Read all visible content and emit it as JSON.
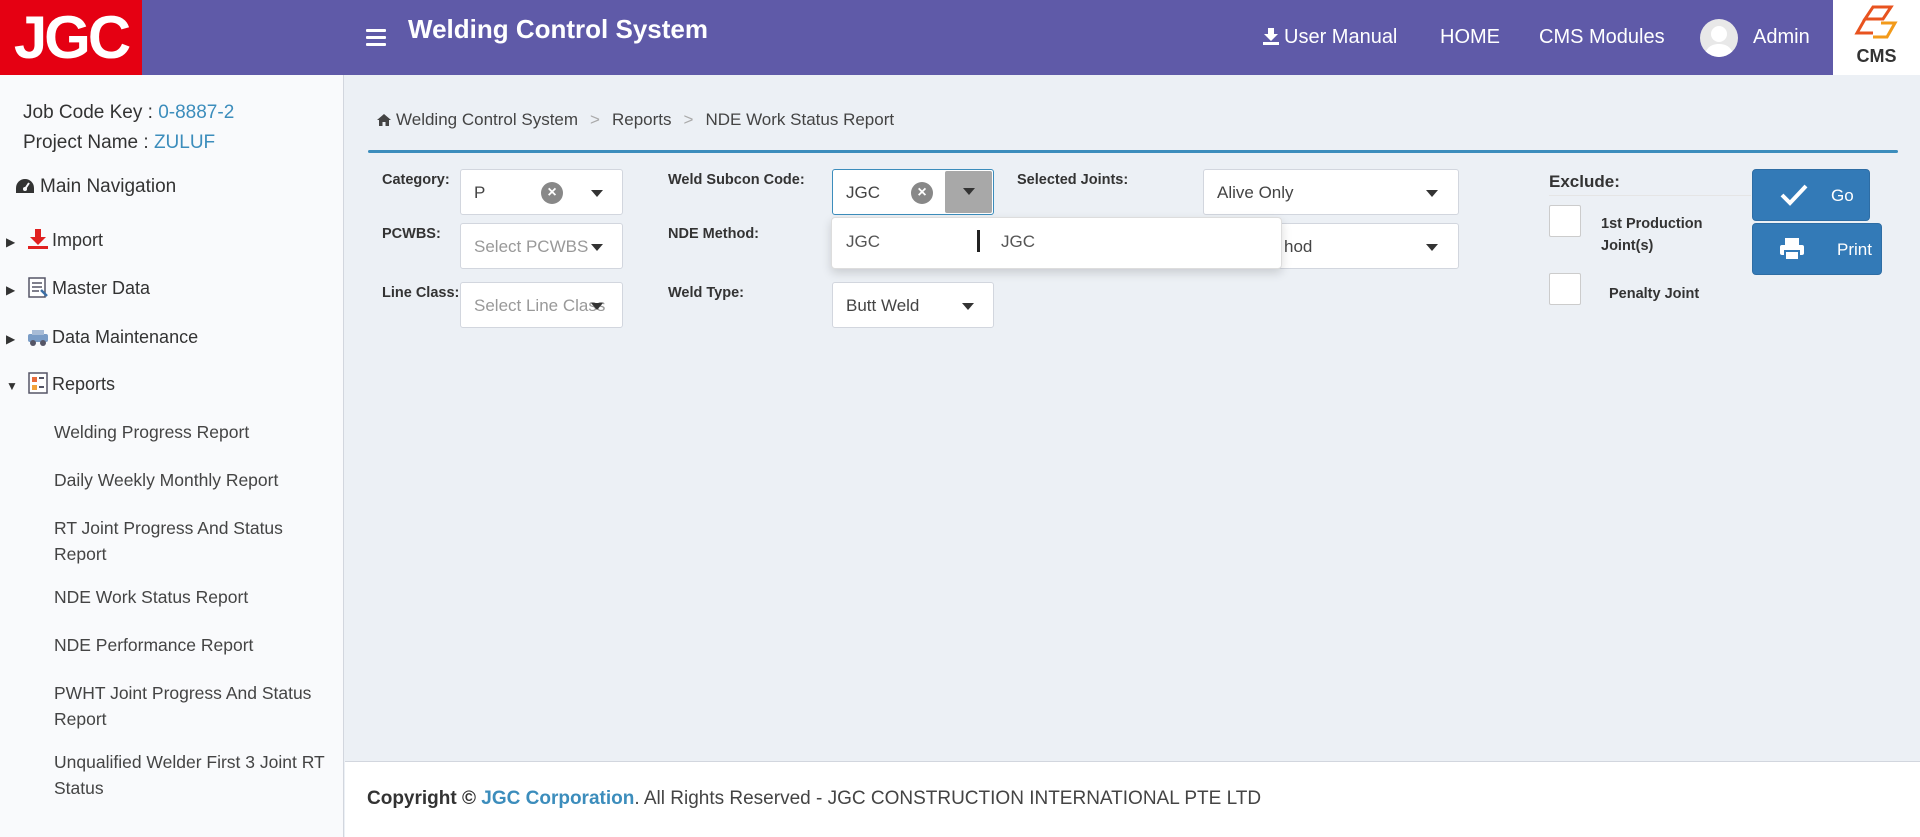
{
  "header": {
    "logo_text": "JGC",
    "app_title": "Welding Control System",
    "nav": {
      "user_manual": "User Manual",
      "home": "HOME",
      "cms_modules": "CMS Modules",
      "user_name": "Admin"
    },
    "cms_logo_text": "CMS",
    "colors": {
      "header_bg": "#5f5aa8",
      "logo_bg": "#e50012"
    }
  },
  "sidebar": {
    "job_code_label": "Job Code Key :",
    "job_code_value": "0-8887-2",
    "project_label": "Project Name :",
    "project_value": "ZULUF",
    "main_nav_label": "Main Navigation",
    "nodes": [
      {
        "label": "Import",
        "icon": "import-icon",
        "expanded": false
      },
      {
        "label": "Master Data",
        "icon": "master-data-icon",
        "expanded": false
      },
      {
        "label": "Data Maintenance",
        "icon": "data-maintenance-icon",
        "expanded": false
      },
      {
        "label": "Reports",
        "icon": "reports-icon",
        "expanded": true
      }
    ],
    "report_items": [
      "Welding Progress Report",
      "Daily Weekly Monthly Report",
      "RT Joint Progress And Status Report",
      "NDE Work Status Report",
      "NDE Performance Report",
      "PWHT Joint Progress And Status Report",
      "Unqualified Welder First 3 Joint RT Status"
    ]
  },
  "breadcrumb": {
    "items": [
      "Welding Control System",
      "Reports",
      "NDE Work Status Report"
    ],
    "separator": ">"
  },
  "form": {
    "category": {
      "label": "Category:",
      "value": "P"
    },
    "pcwbs": {
      "label": "PCWBS:",
      "placeholder": "Select PCWBS"
    },
    "line_class": {
      "label": "Line Class:",
      "placeholder": "Select Line Class"
    },
    "weld_subcon": {
      "label": "Weld Subcon Code:",
      "value": "JGC",
      "options": [
        "JGC",
        "JGC"
      ]
    },
    "nde_method": {
      "label": "NDE Method:",
      "partial_value": "hod"
    },
    "weld_type": {
      "label": "Weld Type:",
      "value": "Butt Weld"
    },
    "selected_joints": {
      "label": "Selected Joints:",
      "value": "Alive Only"
    },
    "exclude": {
      "title": "Exclude:",
      "first_production": "1st Production Joint(s)",
      "penalty": "Penalty Joint"
    },
    "go_label": "Go",
    "print_label": "Print"
  },
  "footer": {
    "copyright": "Copyright ©",
    "corp": "JGC Corporation",
    "rest": ". All Rights Reserved - JGC CONSTRUCTION INTERNATIONAL PTE LTD"
  }
}
